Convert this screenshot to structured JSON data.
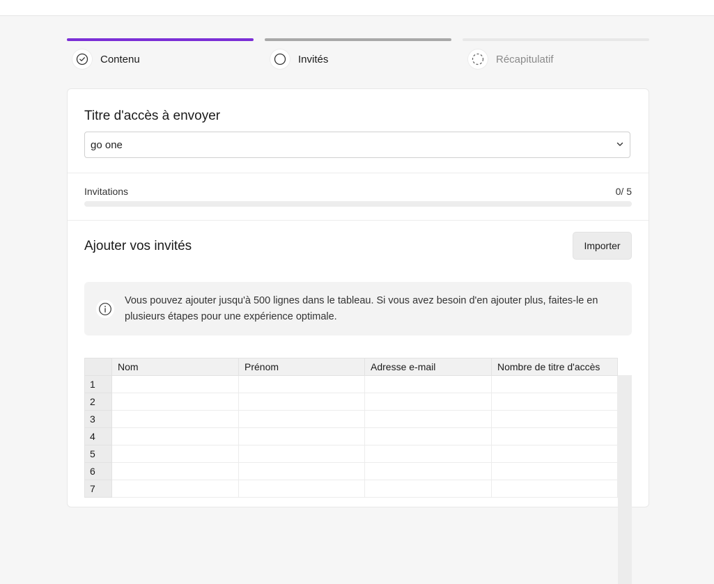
{
  "colors": {
    "accent": "#7b2fd6",
    "step_active_bar": "#7b2fd6",
    "step_next_bar": "#a8a8a8",
    "step_disabled_bar": "#e8e8e8"
  },
  "stepper": {
    "steps": [
      {
        "label": "Contenu",
        "state": "completed",
        "icon": "check-circle-icon"
      },
      {
        "label": "Invités",
        "state": "current",
        "icon": "circle-icon"
      },
      {
        "label": "Récapitulatif",
        "state": "upcoming",
        "icon": "dashed-circle-icon"
      }
    ]
  },
  "access": {
    "title": "Titre d'accès à envoyer",
    "selected_value": "go one"
  },
  "invitations": {
    "label": "Invitations",
    "count_text": "0/ 5",
    "used": 0,
    "max": 5
  },
  "guests": {
    "title": "Ajouter vos invités",
    "import_label": "Importer",
    "notice": "Vous pouvez ajouter jusqu'à 500 lignes dans le tableau. Si vous avez besoin d'en ajouter plus, faites-le en plusieurs étapes pour une expérience optimale."
  },
  "table": {
    "columns": [
      "Nom",
      "Prénom",
      "Adresse e-mail",
      "Nombre de titre d'accès"
    ],
    "row_numbers": [
      "1",
      "2",
      "3",
      "4",
      "5",
      "6",
      "7"
    ]
  }
}
